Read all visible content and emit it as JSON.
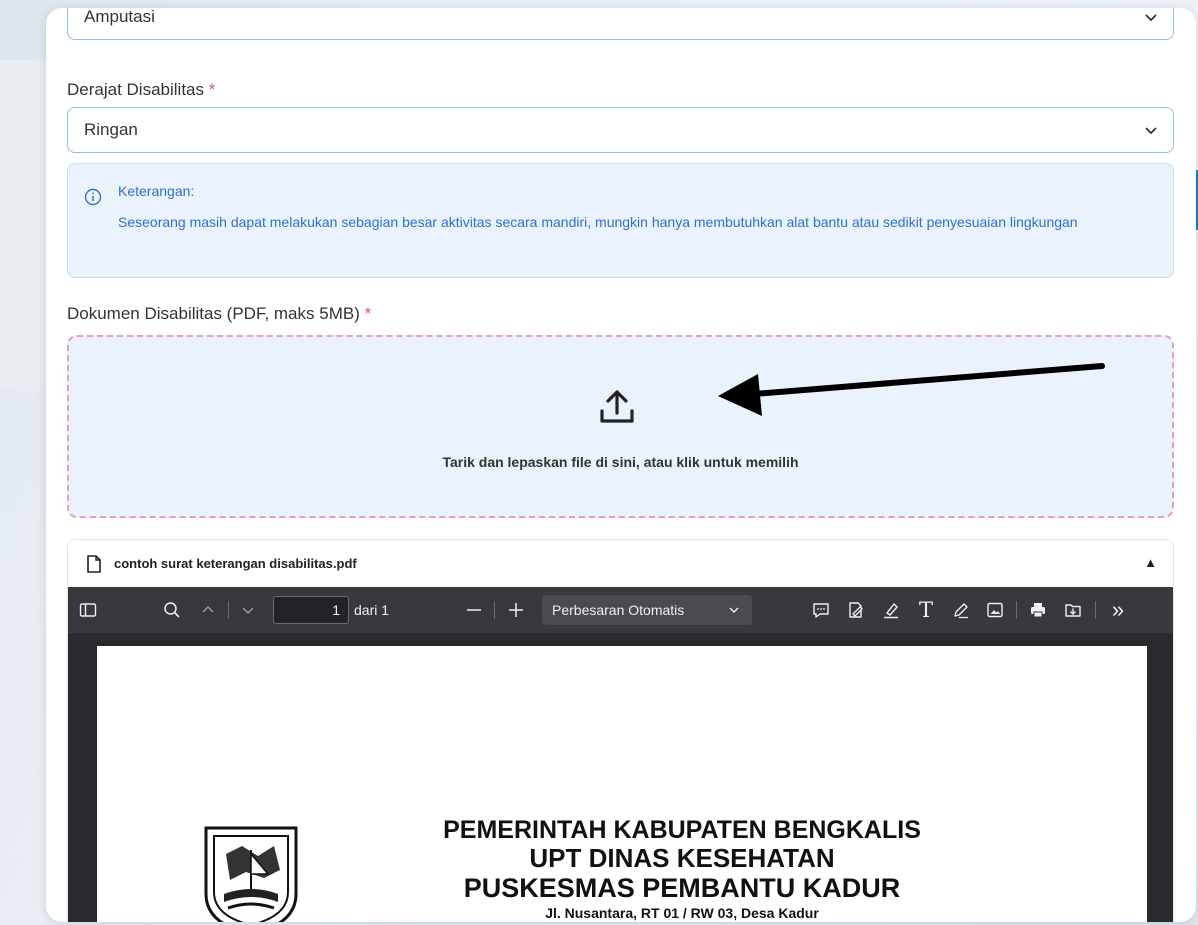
{
  "form": {
    "disability_type": {
      "value": "Amputasi"
    },
    "disability_degree": {
      "label": "Derajat Disabilitas",
      "required_mark": "*",
      "value": "Ringan"
    },
    "info": {
      "title": "Keterangan:",
      "body": "Seseorang masih dapat melakukan sebagian besar aktivitas secara mandiri, mungkin hanya membutuhkan alat bantu atau sedikit penyesuaian lingkungan"
    },
    "document": {
      "label": "Dokumen Disabilitas (PDF, maks 5MB)",
      "required_mark": "*",
      "dropzone_text": "Tarik dan lepaskan file di sini, atau klik untuk memilih"
    }
  },
  "pdf_preview": {
    "filename": "contoh surat keterangan disabilitas.pdf",
    "collapse_glyph": "▲",
    "toolbar": {
      "page_number": "1",
      "page_total": "dari 1",
      "zoom": "Perbesaran Otomatis",
      "text_tool_glyph": "T",
      "more_glyph": "»"
    },
    "document": {
      "line1": "PEMERINTAH KABUPATEN BENGKALIS",
      "line2": "UPT DINAS KESEHATAN",
      "line3": "PUSKESMAS PEMBANTU KADUR",
      "line4": "Jl. Nusantara, RT 01 / RW 03, Desa Kadur"
    }
  },
  "colors": {
    "accent": "#2f6fd0",
    "select_border": "#8cc3e0",
    "dropzone_border": "#e8a0b4",
    "toolbar_bg": "#38383d"
  }
}
